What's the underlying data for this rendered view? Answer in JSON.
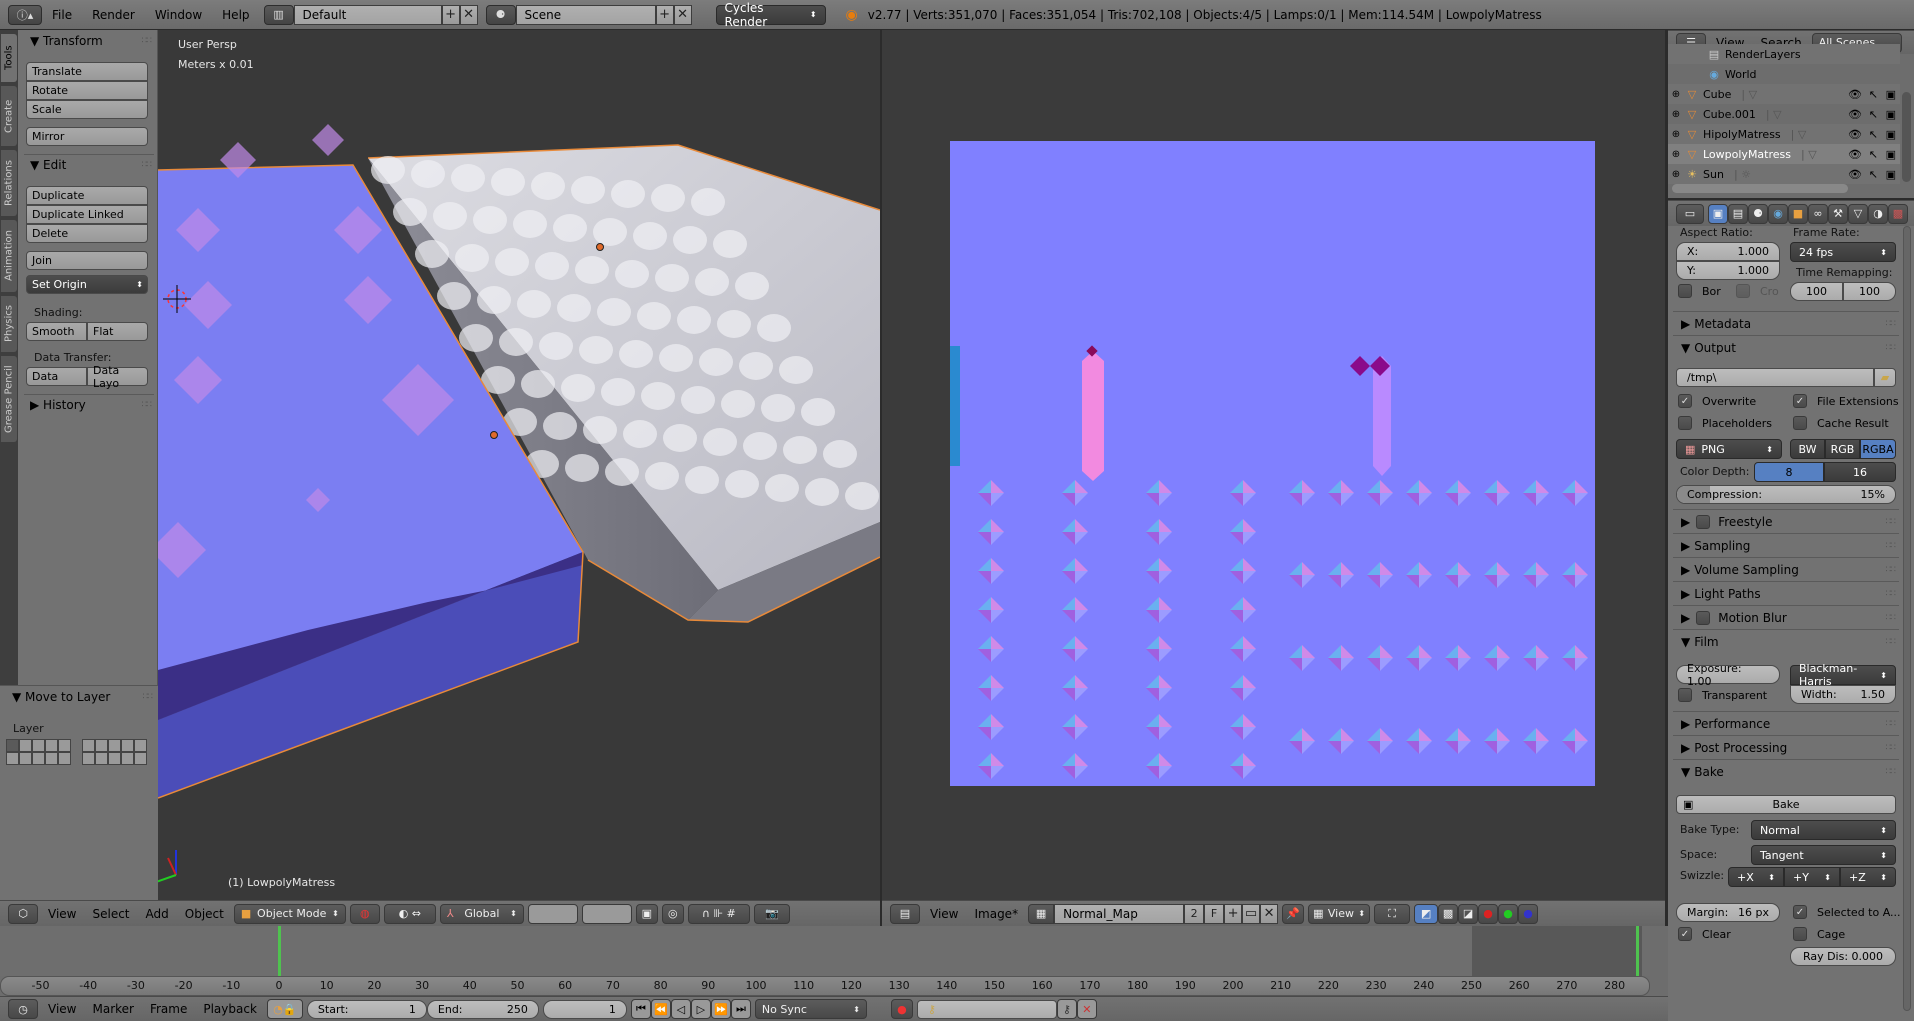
{
  "topbar": {
    "menus": [
      "File",
      "Render",
      "Window",
      "Help"
    ],
    "layout_name": "Default",
    "scene_name": "Scene",
    "render_engine": "Cycles Render",
    "stats": "v2.77 | Verts:351,070 | Faces:351,054 | Tris:702,108 | Objects:4/5 | Lamps:0/1 | Mem:114.54M | LowpolyMatress"
  },
  "tool_tabs": [
    "Tools",
    "Create",
    "Relations",
    "Animation",
    "Physics",
    "Grease Pencil"
  ],
  "tool_panel": {
    "transform_title": "Transform",
    "transform_buttons": [
      "Translate",
      "Rotate",
      "Scale"
    ],
    "mirror": "Mirror",
    "edit_title": "Edit",
    "edit_buttons": [
      "Duplicate",
      "Duplicate Linked",
      "Delete"
    ],
    "join": "Join",
    "set_origin": "Set Origin",
    "shading_label": "Shading:",
    "shading_buttons": [
      "Smooth",
      "Flat"
    ],
    "data_transfer_label": "Data Transfer:",
    "data_transfer_buttons": [
      "Data",
      "Data Layo"
    ],
    "history_title": "History"
  },
  "operator_panel": {
    "title": "Move to Layer",
    "layer_label": "Layer"
  },
  "viewport": {
    "view_name": "User Persp",
    "units": "Meters x 0.01",
    "active_object": "(1) LowpolyMatress",
    "header": {
      "menus": [
        "View",
        "Select",
        "Add",
        "Object"
      ],
      "mode": "Object Mode",
      "orientation": "Global"
    }
  },
  "image_editor": {
    "header": {
      "menus": [
        "View",
        "Image*"
      ],
      "image_name": "Normal_Map",
      "users": "2",
      "fake_user": "F",
      "display_mode": "View"
    },
    "background_color": "#8080ff"
  },
  "outliner": {
    "menus": [
      "View",
      "Search"
    ],
    "filter": "All Scenes",
    "items": [
      {
        "name": "RenderLayers",
        "type": "renderlayers"
      },
      {
        "name": "World",
        "type": "world"
      },
      {
        "name": "Cube",
        "type": "mesh"
      },
      {
        "name": "Cube.001",
        "type": "mesh"
      },
      {
        "name": "HipolyMatress",
        "type": "mesh"
      },
      {
        "name": "LowpolyMatress",
        "type": "mesh",
        "selected": true
      },
      {
        "name": "Sun",
        "type": "lamp"
      }
    ]
  },
  "properties": {
    "aspect_ratio_label": "Aspect Ratio:",
    "aspect_x": {
      "label": "X:",
      "value": "1.000"
    },
    "aspect_y": {
      "label": "Y:",
      "value": "1.000"
    },
    "frame_rate_label": "Frame Rate:",
    "frame_rate": "24 fps",
    "time_remapping_label": "Time Remapping:",
    "time_remap_old": "100",
    "time_remap_new": "100",
    "border": "Bor",
    "crop": "Cro",
    "sections": {
      "metadata": "Metadata",
      "output": "Output",
      "freestyle": "Freestyle",
      "sampling": "Sampling",
      "volume_sampling": "Volume Sampling",
      "light_paths": "Light Paths",
      "motion_blur": "Motion Blur",
      "film": "Film",
      "performance": "Performance",
      "post_processing": "Post Processing",
      "bake": "Bake"
    },
    "output": {
      "path": "/tmp\\",
      "overwrite": {
        "label": "Overwrite",
        "checked": true
      },
      "file_extensions": {
        "label": "File Extensions",
        "checked": true
      },
      "placeholders": {
        "label": "Placeholders",
        "checked": false
      },
      "cache_result": {
        "label": "Cache Result",
        "checked": false
      },
      "format": "PNG",
      "color_modes": [
        "BW",
        "RGB",
        "RGBA"
      ],
      "color_mode_active": "RGBA",
      "color_depth_label": "Color Depth:",
      "color_depths": [
        "8",
        "16"
      ],
      "color_depth_active": "8",
      "compression_label": "Compression:",
      "compression": "15%",
      "compression_value": 0.15
    },
    "film": {
      "exposure": "Exposure: 1.00",
      "filter": "Blackman-Harris",
      "transparent": "Transparent",
      "width_label": "Width:",
      "width_value": "1.50"
    },
    "bake": {
      "button": "Bake",
      "bake_type_label": "Bake Type:",
      "bake_type": "Normal",
      "space_label": "Space:",
      "space": "Tangent",
      "swizzle_label": "Swizzle:",
      "swizzle": [
        "+X",
        "+Y",
        "+Z"
      ],
      "margin": "Margin:",
      "margin_value": "16 px",
      "selected_to_active": "Selected to A...",
      "clear": "Clear",
      "cage": "Cage",
      "ray_distance": "Ray Dis: 0.000"
    }
  },
  "timeline": {
    "ticks": [
      "-50",
      "-40",
      "-30",
      "-20",
      "-10",
      "0",
      "10",
      "20",
      "30",
      "40",
      "50",
      "60",
      "70",
      "80",
      "90",
      "100",
      "110",
      "120",
      "130",
      "140",
      "150",
      "160",
      "170",
      "180",
      "190",
      "200",
      "210",
      "220",
      "230",
      "240",
      "250",
      "260",
      "270",
      "280"
    ],
    "menus": [
      "View",
      "Marker",
      "Frame",
      "Playback"
    ],
    "start_label": "Start:",
    "start": "1",
    "end_label": "End:",
    "end": "250",
    "current_frame": "1",
    "sync": "No Sync"
  }
}
